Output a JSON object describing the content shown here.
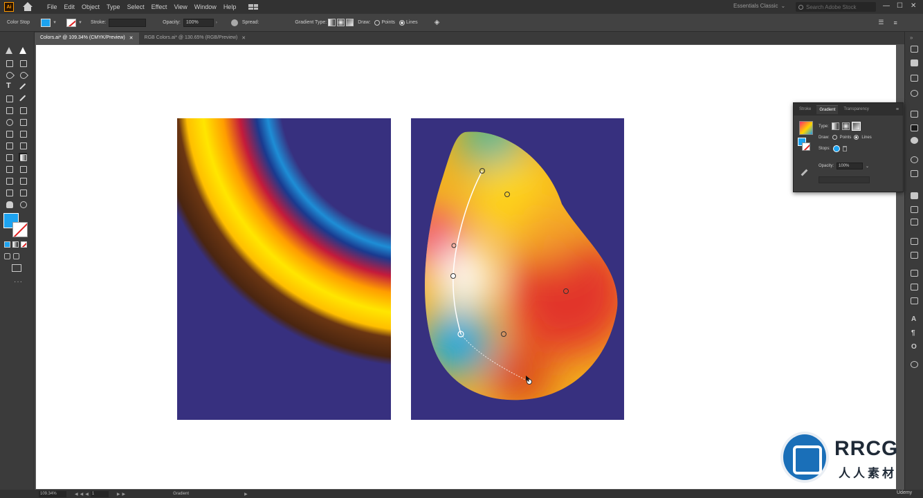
{
  "app": {
    "logo": "Ai"
  },
  "menu": [
    "File",
    "Edit",
    "Object",
    "Type",
    "Select",
    "Effect",
    "View",
    "Window",
    "Help"
  ],
  "workspace": {
    "label": "Essentials Classic"
  },
  "search": {
    "placeholder": "Search Adobe Stock"
  },
  "window_controls": [
    "—",
    "☐",
    "✕"
  ],
  "control_bar": {
    "mode_label": "Color Stop",
    "stroke_label": "Stroke:",
    "opacity_label": "Opacity:",
    "opacity_value": "100%",
    "spread_label": "Spread:",
    "gradient_type_label": "Gradient Type:",
    "draw_label": "Draw:",
    "points_label": "Points",
    "lines_label": "Lines"
  },
  "tabs": [
    {
      "label": "Colors.ai* @ 109.34% (CMYK/Preview)",
      "active": true
    },
    {
      "label": "RGB Colors.ai* @ 130.65% (RGB/Preview)",
      "active": false
    }
  ],
  "gradient_panel": {
    "tabs": [
      "Stroke",
      "Gradient",
      "Transparency"
    ],
    "type_label": "Type:",
    "draw_label": "Draw:",
    "points_label": "Points",
    "lines_label": "Lines",
    "stops_label": "Stops:",
    "opacity_label": "Opacity:",
    "opacity_value": "100%"
  },
  "status": {
    "zoom": "109.34%",
    "page": "1",
    "tool": "Gradient"
  },
  "watermark": {
    "brand": "RRCG",
    "subtitle": "人人素材",
    "credit": "Udemy"
  },
  "colors": {
    "navy": "#37307f",
    "fill_swatch": "#1da3f0",
    "canvas": "#ffffff"
  }
}
